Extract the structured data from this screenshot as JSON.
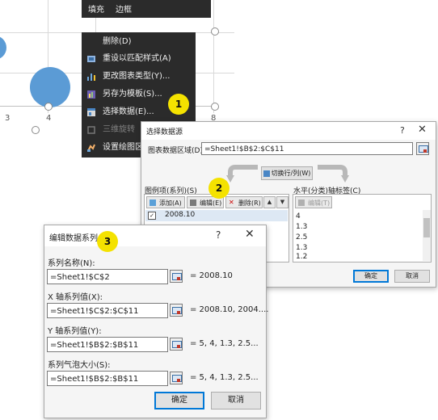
{
  "chart": {
    "axis_ticks": [
      "3",
      "4",
      "8"
    ],
    "bubble_color": "#5b9bd5"
  },
  "mini_toolbar": {
    "fill_label": "填充",
    "border_label": "边框"
  },
  "context_menu": {
    "items": [
      {
        "label": "删除(D)",
        "icon": "delete-icon",
        "enabled": true
      },
      {
        "label": "重设以匹配样式(A)",
        "icon": "reset-style-icon",
        "enabled": true
      },
      {
        "label": "更改图表类型(Y)...",
        "icon": "chart-type-icon",
        "enabled": true
      },
      {
        "label": "另存为模板(S)...",
        "icon": "template-icon",
        "enabled": true
      },
      {
        "label": "选择数据(E)...",
        "icon": "select-data-icon",
        "enabled": true
      },
      {
        "label": "三维旋转",
        "icon": "rotate-3d-icon",
        "enabled": false
      },
      {
        "label": "设置绘图区",
        "icon": "format-plot-icon",
        "enabled": true
      }
    ]
  },
  "badges": {
    "one": "1",
    "two": "2",
    "three": "3"
  },
  "select_source": {
    "title": "选择数据源",
    "help": "?",
    "close": "✕",
    "range_label": "图表数据区域(D):",
    "range_value": "=Sheet1!$B$2:$C$11",
    "switch_label": "切换行/列(W)",
    "series_label": "图例项(系列)(S)",
    "add_label": "添加(A)",
    "edit_label": "编辑(E)",
    "delete_label": "删除(R)",
    "series_items": [
      "2008.10"
    ],
    "axis_label": "水平(分类)轴标签(C)",
    "axis_edit_label": "编辑(T)",
    "axis_items": [
      "4",
      "1.3",
      "2.5",
      "1.3",
      "1.2"
    ],
    "ok_label": "确定",
    "cancel_label": "取消"
  },
  "edit_series": {
    "title": "编辑数据系列",
    "help": "?",
    "close": "✕",
    "name_label": "系列名称(N):",
    "name_value": "=Sheet1!$C$2",
    "name_preview": "= 2008.10",
    "x_label": "X 轴系列值(X):",
    "x_value": "=Sheet1!$C$2:$C$11",
    "x_preview": "= 2008.10, 2004....",
    "y_label": "Y 轴系列值(Y):",
    "y_value": "=Sheet1!$B$2:$B$11",
    "y_preview": "= 5, 4, 1.3, 2.5...",
    "size_label": "系列气泡大小(S):",
    "size_value": "=Sheet1!$B$2:$B$11",
    "size_preview": "= 5, 4, 1.3, 2.5...",
    "ok_label": "确定",
    "cancel_label": "取消"
  }
}
